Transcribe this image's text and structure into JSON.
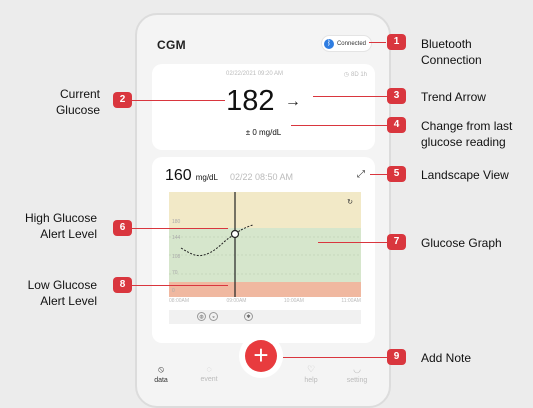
{
  "app": {
    "title": "CGM",
    "bluetooth_status": "Connected"
  },
  "current_card": {
    "timestamp": "02/22/2021 09:20 AM",
    "sensor_days": "8D 1h",
    "glucose_value": "182",
    "trend_arrow": "→",
    "change": "± 0 mg/dL"
  },
  "graph_card": {
    "value": "160",
    "unit": "mg/dL",
    "time": "02/22 08:50 AM",
    "y_ticks": [
      "180",
      "144",
      "108",
      "70",
      "0"
    ],
    "x_ticks": [
      "08:00AM",
      "09:00AM",
      "10:00AM",
      "11:00AM"
    ]
  },
  "nav": {
    "items": [
      {
        "label": "data"
      },
      {
        "label": "event"
      },
      {
        "label": "help"
      },
      {
        "label": "setting"
      }
    ]
  },
  "annotations": [
    {
      "number": "1",
      "label": "Bluetooth Connection"
    },
    {
      "number": "2",
      "label": "Current Glucose"
    },
    {
      "number": "3",
      "label": "Trend Arrow"
    },
    {
      "number": "4",
      "label": "Change from last glucose reading"
    },
    {
      "number": "5",
      "label": "Landscape View"
    },
    {
      "number": "6",
      "label": "High Glucose Alert Level"
    },
    {
      "number": "7",
      "label": "Glucose Graph"
    },
    {
      "number": "8",
      "label": "Low Glucose Alert Level"
    },
    {
      "number": "9",
      "label": "Add Note"
    }
  ],
  "colors": {
    "accent": "#e83b3e",
    "callout": "#d9363e",
    "high_band": "#f2e9c7",
    "target_band": "#d6e6cc",
    "low_band": "#f0b8a0"
  }
}
